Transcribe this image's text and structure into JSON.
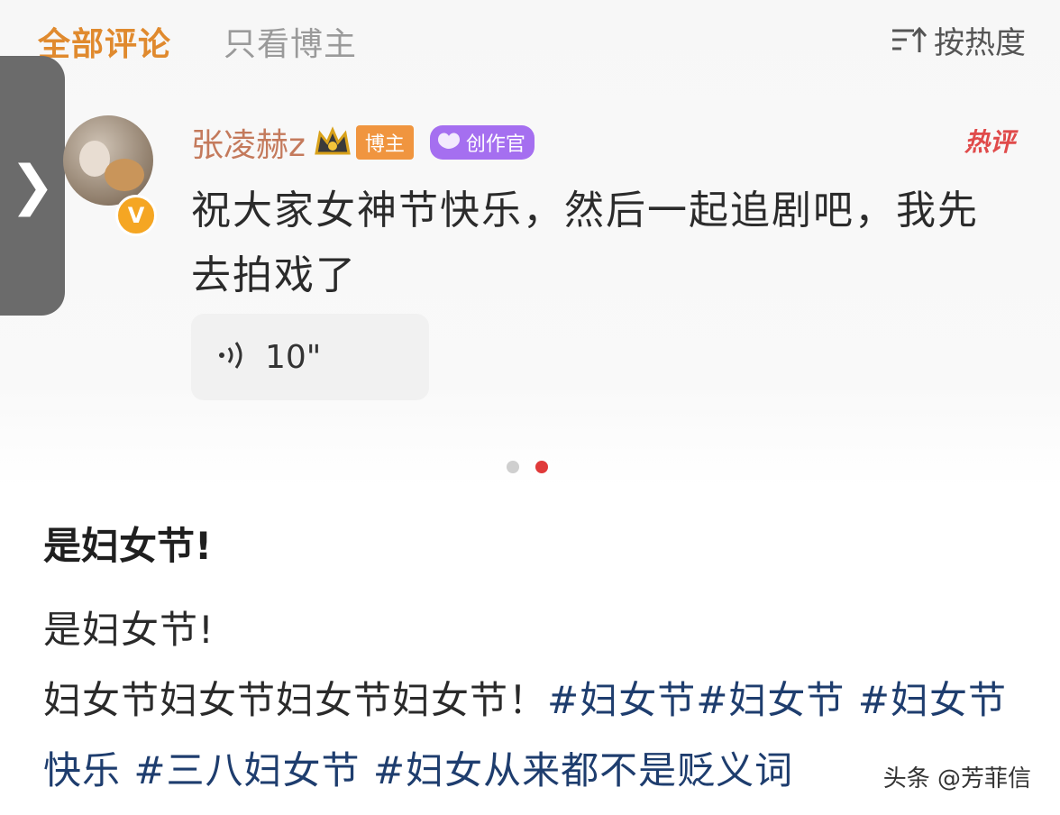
{
  "tabs": {
    "all_comments": "全部评论",
    "blogger_only": "只看博主"
  },
  "sort": {
    "label": "按热度",
    "icon": "sort-icon"
  },
  "back_button": {
    "glyph": "❯",
    "icon": "chevron-right-icon"
  },
  "comment": {
    "username": "张凌赫z",
    "badges": {
      "blogger": "博主",
      "creator": "创作官"
    },
    "verified_glyph": "V",
    "hot_label": "热评",
    "text": "祝大家女神节快乐，然后一起追剧吧，我先去拍戏了",
    "voice": {
      "duration": "10\"",
      "icon": "sound-wave-icon"
    }
  },
  "carousel": {
    "count": 2,
    "active_index": 1
  },
  "article": {
    "title": "是妇女节!",
    "line1": "是妇女节!",
    "line2_text": "妇女节妇女节妇女节妇女节！",
    "hashtags": [
      "#妇女节",
      "#妇女节 ",
      "#妇女节快乐 ",
      "#三八妇女节 ",
      "#妇女从来都不是贬义词"
    ]
  },
  "watermark": "头条 @芳菲信",
  "colors": {
    "accent_tab": "#e08a2e",
    "username": "#c47a5c",
    "hot": "#e04a4a",
    "hashtag": "#1e3d6e",
    "dot_active": "#e03a3a"
  }
}
